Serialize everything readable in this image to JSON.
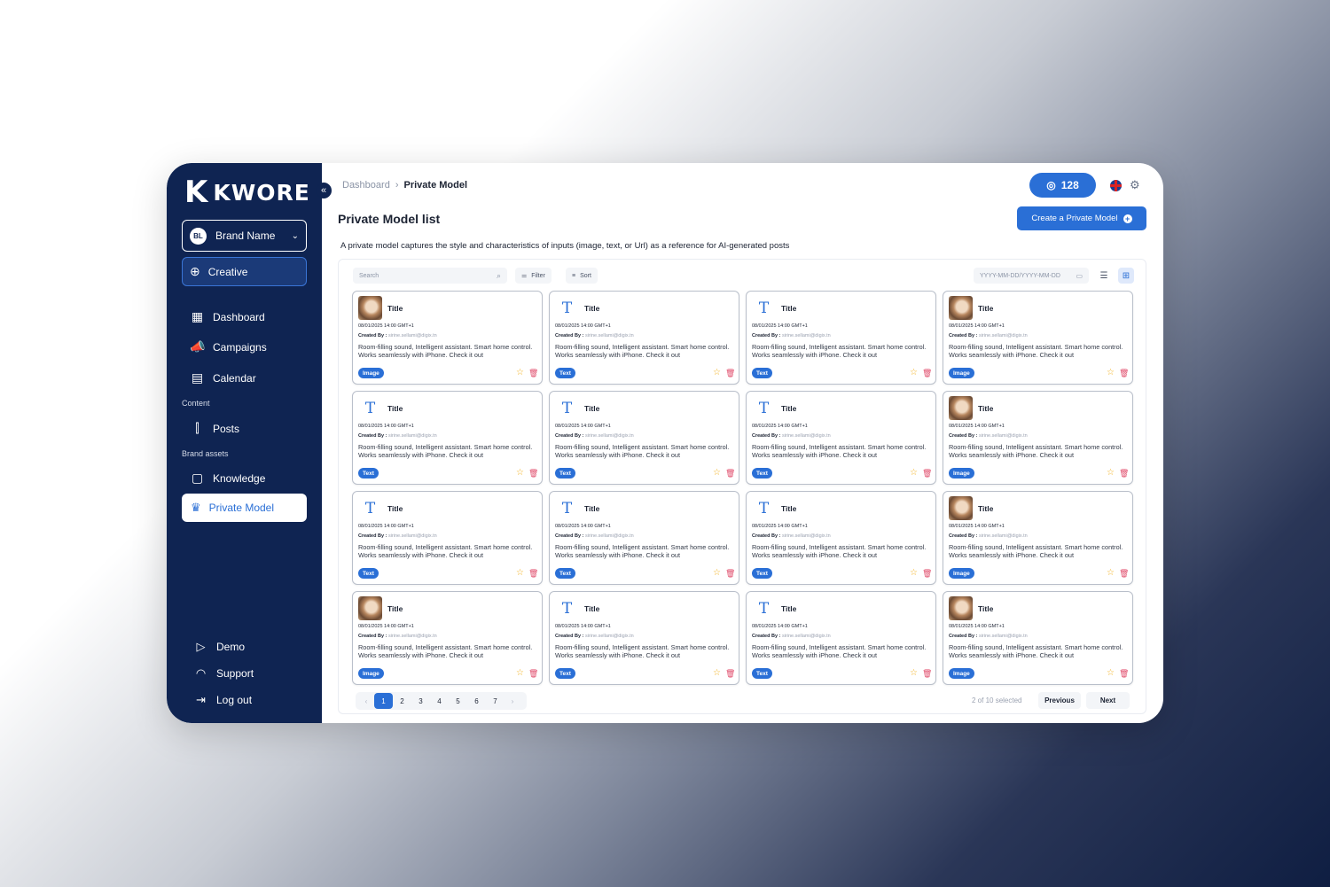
{
  "brand": {
    "logo_text": "KWORE",
    "logo_mark": "K"
  },
  "sidebar": {
    "brand_select": {
      "initials": "BL",
      "label": "Brand Name"
    },
    "creative_label": "Creative",
    "items": [
      {
        "label": "Dashboard",
        "icon": "dashboard-icon"
      },
      {
        "label": "Campaigns",
        "icon": "megaphone-icon"
      },
      {
        "label": "Calendar",
        "icon": "calendar-icon"
      }
    ],
    "section_content": "Content",
    "posts_label": "Posts",
    "section_brand_assets": "Brand assets",
    "knowledge_label": "Knowledge",
    "private_model_label": "Private Model",
    "bottom": [
      {
        "label": "Demo",
        "icon": "play-icon"
      },
      {
        "label": "Support",
        "icon": "headset-icon"
      },
      {
        "label": "Log out",
        "icon": "logout-icon"
      }
    ]
  },
  "header": {
    "breadcrumb": {
      "parent": "Dashboard",
      "current": "Private Model"
    },
    "credits": "128",
    "accent_color": "#2a6fd6"
  },
  "page": {
    "title": "Private Model list",
    "create_button": "Create a Private Model",
    "description": "A private model captures the style and characteristics of inputs (image, text, or Url) as a reference for AI-generated posts"
  },
  "toolbar": {
    "search_placeholder": "Search",
    "filter_label": "Filter",
    "sort_label": "Sort",
    "date_placeholder": "YYYY-MM-DD/YYYY-MM-DD"
  },
  "cards": [
    {
      "type": "image",
      "title": "Title",
      "date": "08/01/2025 14:00 GMT+1",
      "author_prefix": "Created By :",
      "author": "sirine.sellami@digix.tn",
      "desc": "Room-filling sound, Intelligent assistant. Smart home control. Works seamlessly with iPhone. Check it out",
      "tag": "Image"
    },
    {
      "type": "text",
      "title": "Title",
      "date": "08/01/2025 14:00 GMT+1",
      "author_prefix": "Created By :",
      "author": "sirine.sellami@digix.tn",
      "desc": "Room-filling sound, Intelligent assistant. Smart home control. Works seamlessly with iPhone. Check it out",
      "tag": "Text"
    },
    {
      "type": "text",
      "title": "Title",
      "date": "08/01/2025 14:00 GMT+1",
      "author_prefix": "Created By :",
      "author": "sirine.sellami@digix.tn",
      "desc": "Room-filling sound, Intelligent assistant. Smart home control. Works seamlessly with iPhone. Check it out",
      "tag": "Text"
    },
    {
      "type": "image",
      "title": "Title",
      "date": "08/01/2025 14:00 GMT+1",
      "author_prefix": "Created By :",
      "author": "sirine.sellami@digix.tn",
      "desc": "Room-filling sound, Intelligent assistant. Smart home control. Works seamlessly with iPhone. Check it out",
      "tag": "Image"
    },
    {
      "type": "text",
      "title": "Title",
      "date": "08/01/2025 14:00 GMT+1",
      "author_prefix": "Created By :",
      "author": "sirine.sellami@digix.tn",
      "desc": "Room-filling sound, Intelligent assistant. Smart home control. Works seamlessly with iPhone. Check it out",
      "tag": "Text"
    },
    {
      "type": "text",
      "title": "Title",
      "date": "08/01/2025 14:00 GMT+1",
      "author_prefix": "Created By :",
      "author": "sirine.sellami@digix.tn",
      "desc": "Room-filling sound, Intelligent assistant. Smart home control. Works seamlessly with iPhone. Check it out",
      "tag": "Text"
    },
    {
      "type": "text",
      "title": "Title",
      "date": "08/01/2025 14:00 GMT+1",
      "author_prefix": "Created By :",
      "author": "sirine.sellami@digix.tn",
      "desc": "Room-filling sound, Intelligent assistant. Smart home control. Works seamlessly with iPhone. Check it out",
      "tag": "Text"
    },
    {
      "type": "image",
      "title": "Title",
      "date": "08/01/2025 14:00 GMT+1",
      "author_prefix": "Created By :",
      "author": "sirine.sellami@digix.tn",
      "desc": "Room-filling sound, Intelligent assistant. Smart home control. Works seamlessly with iPhone. Check it out",
      "tag": "Image"
    },
    {
      "type": "text",
      "title": "Title",
      "date": "08/01/2025 14:00 GMT+1",
      "author_prefix": "Created By :",
      "author": "sirine.sellami@digix.tn",
      "desc": "Room-filling sound, Intelligent assistant. Smart home control. Works seamlessly with iPhone. Check it out",
      "tag": "Text"
    },
    {
      "type": "text",
      "title": "Title",
      "date": "08/01/2025 14:00 GMT+1",
      "author_prefix": "Created By :",
      "author": "sirine.sellami@digix.tn",
      "desc": "Room-filling sound, Intelligent assistant. Smart home control. Works seamlessly with iPhone. Check it out",
      "tag": "Text"
    },
    {
      "type": "text",
      "title": "Title",
      "date": "08/01/2025 14:00 GMT+1",
      "author_prefix": "Created By :",
      "author": "sirine.sellami@digix.tn",
      "desc": "Room-filling sound, Intelligent assistant. Smart home control. Works seamlessly with iPhone. Check it out",
      "tag": "Text"
    },
    {
      "type": "image",
      "title": "Title",
      "date": "08/01/2025 14:00 GMT+1",
      "author_prefix": "Created By :",
      "author": "sirine.sellami@digix.tn",
      "desc": "Room-filling sound, Intelligent assistant. Smart home control. Works seamlessly with iPhone. Check it out",
      "tag": "Image"
    },
    {
      "type": "image",
      "title": "Title",
      "date": "08/01/2025 14:00 GMT+1",
      "author_prefix": "Created By :",
      "author": "sirine.sellami@digix.tn",
      "desc": "Room-filling sound, Intelligent assistant. Smart home control. Works seamlessly with iPhone. Check it out",
      "tag": "Image"
    },
    {
      "type": "text",
      "title": "Title",
      "date": "08/01/2025 14:00 GMT+1",
      "author_prefix": "Created By :",
      "author": "sirine.sellami@digix.tn",
      "desc": "Room-filling sound, Intelligent assistant. Smart home control. Works seamlessly with iPhone. Check it out",
      "tag": "Text"
    },
    {
      "type": "text",
      "title": "Title",
      "date": "08/01/2025 14:00 GMT+1",
      "author_prefix": "Created By :",
      "author": "sirine.sellami@digix.tn",
      "desc": "Room-filling sound, Intelligent assistant. Smart home control. Works seamlessly with iPhone. Check it out",
      "tag": "Text"
    },
    {
      "type": "image",
      "title": "Title",
      "date": "08/01/2025 14:00 GMT+1",
      "author_prefix": "Created By :",
      "author": "sirine.sellami@digix.tn",
      "desc": "Room-filling sound, Intelligent assistant. Smart home control. Works seamlessly with iPhone. Check it out",
      "tag": "Image"
    }
  ],
  "pagination": {
    "pages": [
      "1",
      "2",
      "3",
      "4",
      "5",
      "6",
      "7"
    ],
    "current": "1",
    "selected_text": "2 of 10 selected",
    "previous": "Previous",
    "next": "Next"
  }
}
